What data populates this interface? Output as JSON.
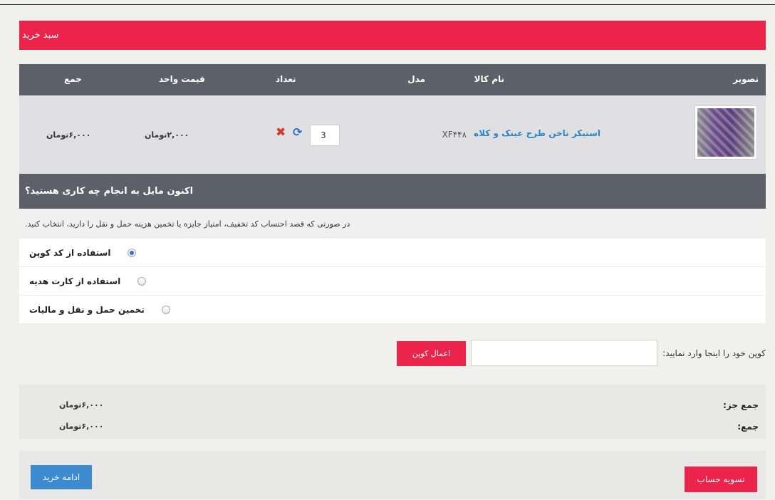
{
  "cart": {
    "title": "سبد خرید",
    "columns": {
      "image": "تصویر",
      "name": "نام کالا",
      "model": "مدل",
      "quantity": "تعداد",
      "unit_price": "قیمت واحد",
      "total": "جمع"
    },
    "items": [
      {
        "name": "استیکر ناخن طرح عینک و کلاه",
        "model": "XF۴۴۸",
        "quantity": "3",
        "unit_price": "۲,۰۰۰تومان",
        "total": "۶,۰۰۰تومان"
      }
    ]
  },
  "whatnext": {
    "title": "اکنون مایل به انجام چه کاری هستید؟",
    "description": "در صورتی که قصد احتساب کد تخفیف، امتیاز جایزه یا تخمین هزینه حمل و نقل را دارید، انتخاب کنید.",
    "options": [
      {
        "label": "استفاده از کد کوپن",
        "checked": true
      },
      {
        "label": "استفاده از کارت هدیه",
        "checked": false
      },
      {
        "label": "تخمین حمل و نقل و مالیات",
        "checked": false
      }
    ]
  },
  "coupon": {
    "label": "کوپن خود را اینجا وارد نمایید:",
    "value": "",
    "button": "اعمال کوپن"
  },
  "totals": {
    "subtotal_label": "جمع جز:",
    "subtotal_value": "۶,۰۰۰تومان",
    "total_label": "جمع:",
    "total_value": "۶,۰۰۰تومان"
  },
  "actions": {
    "checkout": "تسویه حساب",
    "continue": "ادامه خرید"
  },
  "colors": {
    "accent_red": "#ec234a",
    "header_gray": "#5c6069",
    "link_blue": "#2a86c8",
    "button_blue": "#3c8ad0"
  }
}
